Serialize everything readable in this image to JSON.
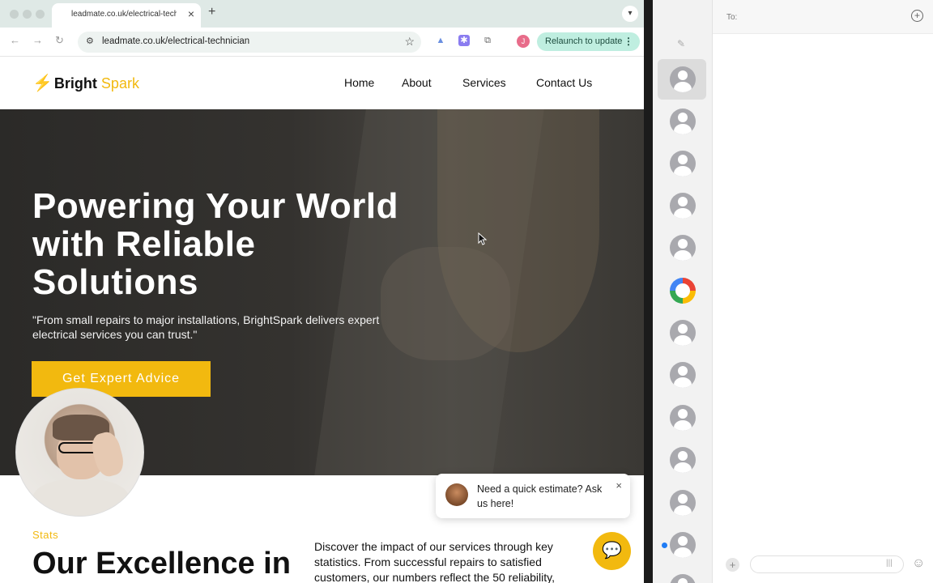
{
  "browser": {
    "tab_title": "leadmate.co.uk/electrical-technician",
    "url": "leadmate.co.uk/electrical-technician",
    "profile_initial": "J",
    "relaunch_label": "Relaunch to update"
  },
  "site": {
    "logo_main": "Bright",
    "logo_accent": "Spark",
    "nav": [
      "Home",
      "About",
      "Services",
      "Contact Us"
    ],
    "hero": {
      "title": "Powering Your World with Reliable Solutions",
      "subtitle": "\"From small repairs to major installations, BrightSpark delivers expert electrical services you can trust.\"",
      "cta": "Get Expert Advice"
    },
    "stats": {
      "label": "Stats",
      "title": "Our Excellence in",
      "text": "Discover the impact of our services through key statistics. From successful repairs to satisfied customers, our numbers reflect the 50 reliability,"
    },
    "chat": {
      "message": "Need a quick estimate? Ask us here!"
    }
  },
  "messages": {
    "to_label": "To:",
    "conversations": [
      {
        "avatar": "person-icon",
        "selected": true
      },
      {
        "avatar": "person-icon"
      },
      {
        "avatar": "person-icon"
      },
      {
        "avatar": "person-icon"
      },
      {
        "avatar": "person-icon"
      },
      {
        "avatar": "google-icon"
      },
      {
        "avatar": "person-icon"
      },
      {
        "avatar": "person-icon"
      },
      {
        "avatar": "person-icon"
      },
      {
        "avatar": "person-icon"
      },
      {
        "avatar": "person-icon"
      },
      {
        "avatar": "person-icon",
        "unread": true
      }
    ]
  },
  "colors": {
    "brand_accent": "#f2b90f",
    "relaunch_bg": "#bfeee0",
    "unread_blue": "#1f7cf5"
  }
}
